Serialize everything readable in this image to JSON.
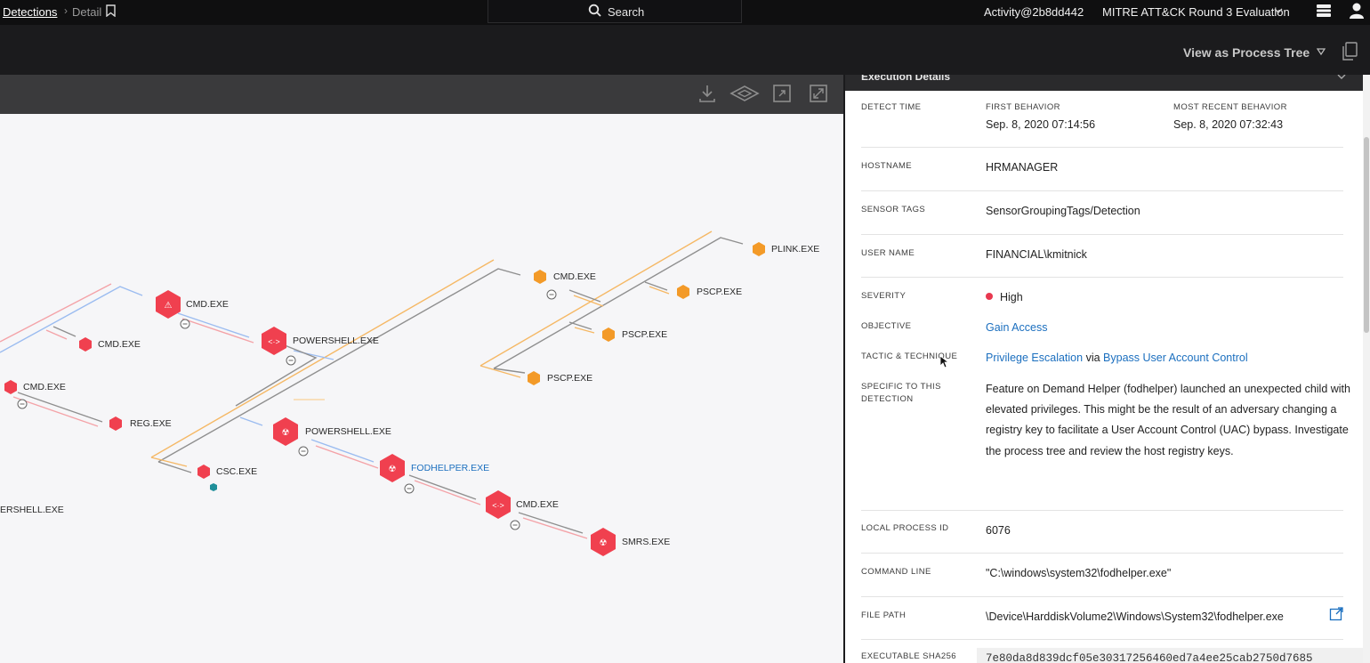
{
  "topbar": {
    "breadcrumb_root": "Detections",
    "breadcrumb_current": "Detail",
    "search_label": "Search",
    "activity": "Activity@2b8dd442",
    "customer": "MITRE ATT&CK Round 3 Evaluation"
  },
  "subbar": {
    "view_as": "View as Process Tree"
  },
  "graph": {
    "nodes": [
      {
        "label": "CMD.EXE",
        "style": "large-red"
      },
      {
        "label": "CMD.EXE",
        "style": "small-red"
      },
      {
        "label": "POWERSHELL.EXE",
        "style": "large-red"
      },
      {
        "label": "CMD.EXE",
        "style": "small-red"
      },
      {
        "label": "REG.EXE",
        "style": "small-red"
      },
      {
        "label": "POWERSHELL.EXE",
        "style": "large-red"
      },
      {
        "label": "CSC.EXE",
        "style": "small-red"
      },
      {
        "label": "FODHELPER.EXE",
        "style": "large-red-selected"
      },
      {
        "label": "CMD.EXE",
        "style": "large-red"
      },
      {
        "label": "SMRS.EXE",
        "style": "large-red"
      },
      {
        "label": "ERSHELL.EXE",
        "style": "partial"
      },
      {
        "label": "CMD.EXE",
        "style": "small-orange"
      },
      {
        "label": "PLINK.EXE",
        "style": "small-orange"
      },
      {
        "label": "PSCP.EXE",
        "style": "small-orange"
      },
      {
        "label": "PSCP.EXE",
        "style": "small-orange"
      },
      {
        "label": "PSCP.EXE",
        "style": "small-orange"
      }
    ]
  },
  "panel": {
    "section_title": "Execution Details",
    "detect_time_label": "DETECT TIME",
    "first_behavior_label": "FIRST BEHAVIOR",
    "first_behavior": "Sep. 8, 2020 07:14:56",
    "recent_behavior_label": "MOST RECENT BEHAVIOR",
    "recent_behavior": "Sep. 8, 2020 07:32:43",
    "hostname_label": "HOSTNAME",
    "hostname": "HRMANAGER",
    "sensor_tags_label": "SENSOR TAGS",
    "sensor_tags": "SensorGroupingTags/Detection",
    "user_name_label": "USER NAME",
    "user_name": "FINANCIAL\\kmitnick",
    "severity_label": "SEVERITY",
    "severity": "High",
    "objective_label": "OBJECTIVE",
    "objective": "Gain Access",
    "tactic_label": "TACTIC & TECHNIQUE",
    "tactic": "Privilege Escalation",
    "via": "via",
    "technique": "Bypass User Account Control",
    "specific_label_1": "SPECIFIC TO THIS",
    "specific_label_2": "DETECTION",
    "description": "Feature on Demand Helper (fodhelper) launched an unexpected child with elevated privileges. This might be the result of an adversary changing a registry key to facilitate a User Account Control (UAC) bypass. Investigate the process tree and review the host registry keys.",
    "pid_label": "LOCAL PROCESS ID",
    "pid": "6076",
    "cmdline_label": "COMMAND LINE",
    "cmdline": "\"C:\\windows\\system32\\fodhelper.exe\"",
    "filepath_label": "FILE PATH",
    "filepath": "\\Device\\HarddiskVolume2\\Windows\\System32\\fodhelper.exe",
    "sha_label": "EXECUTABLE SHA256",
    "sha": "7e80da8d839dcf05e30317256460ed7a4ee25cab2750d7685"
  },
  "colors": {
    "red": "#f0404f",
    "orange": "#f39a28",
    "link": "#1b6fbf"
  }
}
